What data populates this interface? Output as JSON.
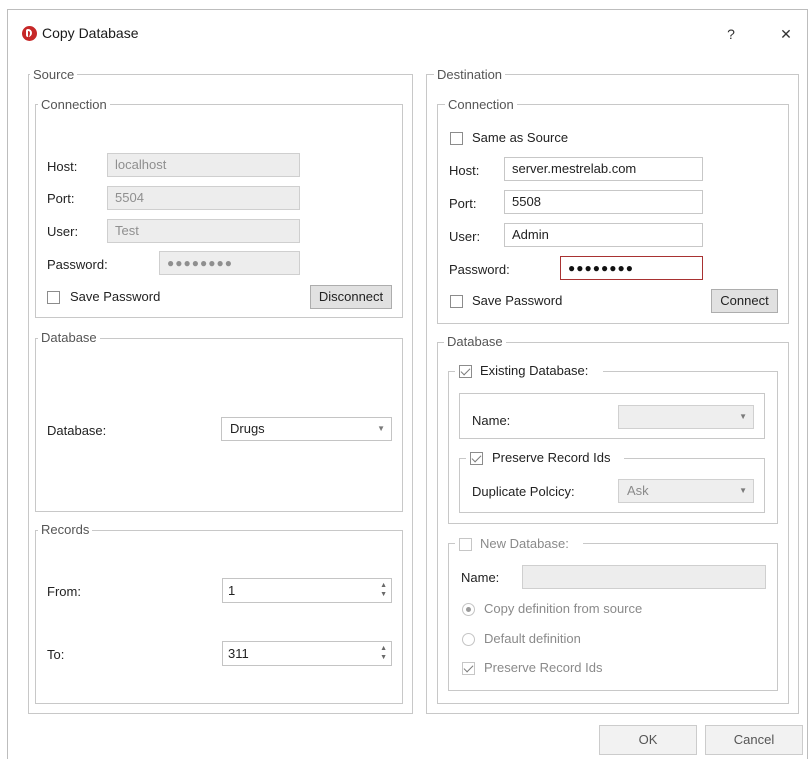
{
  "window": {
    "title": "Copy Database",
    "help_label": "?",
    "close_label": "✕"
  },
  "source": {
    "title": "Source",
    "connection": {
      "title": "Connection",
      "host_label": "Host:",
      "host_value": "localhost",
      "port_label": "Port:",
      "port_value": "5504",
      "user_label": "User:",
      "user_value": "Test",
      "password_label": "Password:",
      "password_value": "●●●●●●●●",
      "save_password_label": "Save Password",
      "save_password_checked": false,
      "disconnect_label": "Disconnect"
    },
    "database": {
      "title": "Database",
      "database_label": "Database:",
      "database_value": "Drugs"
    },
    "records": {
      "title": "Records",
      "from_label": "From:",
      "from_value": "1",
      "to_label": "To:",
      "to_value": "311"
    }
  },
  "destination": {
    "title": "Destination",
    "connection": {
      "title": "Connection",
      "same_as_source_label": "Same as Source",
      "same_as_source_checked": false,
      "host_label": "Host:",
      "host_value": "server.mestrelab.com",
      "port_label": "Port:",
      "port_value": "5508",
      "user_label": "User:",
      "user_value": "Admin",
      "password_label": "Password:",
      "password_value": "●●●●●●●●",
      "save_password_label": "Save Password",
      "save_password_checked": false,
      "connect_label": "Connect"
    },
    "database": {
      "title": "Database",
      "existing": {
        "label": "Existing Database:",
        "checked": true,
        "name_label": "Name:",
        "name_value": "",
        "preserve_label": "Preserve Record Ids",
        "preserve_checked": true,
        "duplicate_policy_label": "Duplicate Polcicy:",
        "duplicate_policy_value": "Ask"
      },
      "new": {
        "label": "New Database:",
        "checked": false,
        "name_label": "Name:",
        "name_value": "",
        "copy_definition_label": "Copy definition from source",
        "default_definition_label": "Default definition",
        "preserve_label": "Preserve Record Ids",
        "preserve_checked": true
      }
    }
  },
  "footer": {
    "ok_label": "OK",
    "cancel_label": "Cancel"
  },
  "icons": {
    "app": "mestrelab-app-icon",
    "dropdown": "chevron-down-icon",
    "spin_up": "spin-up-icon",
    "spin_down": "spin-down-icon"
  },
  "colors": {
    "app_icon": "#c62828",
    "focus_border": "#a83232"
  }
}
